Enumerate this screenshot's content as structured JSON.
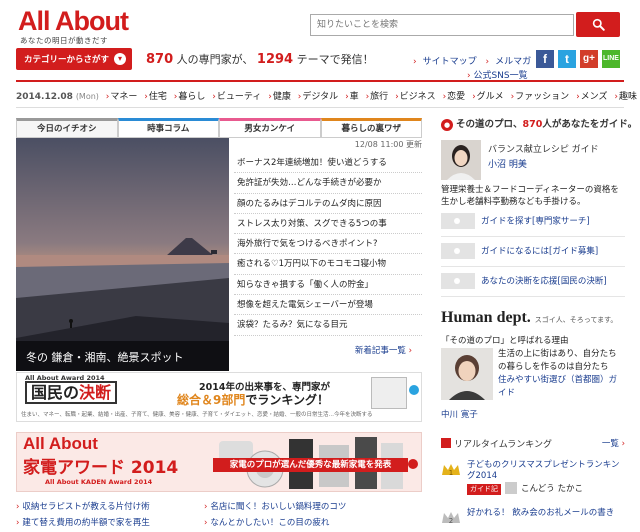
{
  "header": {
    "logo": "All About",
    "tagline": "あなたの明日が動きだす",
    "search_placeholder": "知りたいことを検索",
    "category_button": "カテゴリーからさがす",
    "promo_experts": "870",
    "promo_mid": "人の専門家が、",
    "promo_themes": "1294",
    "promo_end": "テーマで発信！",
    "links": [
      "サイトマップ",
      "メルマガ"
    ],
    "links_sns": "公式SNS一覧"
  },
  "datebar": {
    "date": "2014.12.08",
    "weekday": "(Mon)",
    "categories": [
      "マネー",
      "住宅",
      "暮らし",
      "ビューティ",
      "健康",
      "デジタル",
      "車",
      "旅行",
      "ビジネス",
      "恋愛",
      "グルメ",
      "ファッション",
      "メンズ",
      "趣味"
    ]
  },
  "tabs": [
    "今日のイチオシ",
    "時事コラム",
    "男女カンケイ",
    "暮らしの裏ワザ"
  ],
  "feature": {
    "caption": "冬の 鎌倉・湘南、絶景スポット",
    "timestamp": "12/08 11:00 更新",
    "news": [
      "ボーナス2年連続増加！使い道どうする",
      "免許証が失効…どんな手続きが必要か",
      "顔のたるみはデコルテのムダ肉に原因",
      "ストレス太り対策、スグできる5つの事",
      "海外旅行で気をつけるべきポイント?",
      "癒される♡1万円以下のモコモコ寝小物",
      "知らなきゃ損する「働く人の貯金」",
      "想像を超えた電気シェーバーが登場",
      "涙袋？たるみ？気になる目元"
    ],
    "more_link": "新着記事一覧"
  },
  "banner1": {
    "header": "All About Award 2014",
    "title_a": "国民の",
    "title_b": "決断",
    "line1": "2014年の出来事を、専門家が",
    "line2_a": "総合＆9部門",
    "line2_b": "でランキング！",
    "categories": "住まい、マネー、転職・起業、結婚・出産、子育て、健康、美容・健康、子育て・ダイエット、恋愛・結婚、一般の日常生活…今年を決断する"
  },
  "banner2": {
    "line1": "All About",
    "line2": "家電アワード 2014",
    "line3": "All About KADEN Award 2014",
    "tag": "家電のプロが選んだ優秀な最新家電を発表"
  },
  "bottom_links": [
    [
      "収納セラピストが教える片付け術",
      "名店に聞く！おいしい鍋料理のコツ"
    ],
    [
      "建て替え費用の約半額で家を再生",
      "なんとかしたい！この目の疲れ"
    ]
  ],
  "right": {
    "intro_a": "その道のプロ、",
    "intro_count": "870",
    "intro_b": "人があなたをガイド。",
    "guide_title": "バランス献立レシピ ガイド",
    "guide_name": "小沼 明美",
    "guide_desc": "管理栄養士＆フードコーディネーターの資格を生かし老舗料亭勤務なども手掛ける。",
    "actions": [
      "ガイドを探す[専門家サーチ]",
      "ガイドになるには[ガイド募集]",
      "あなたの決断を応援[国民の決断]"
    ],
    "human_title": "Human dept.",
    "human_tagline": "スゴイ人、そろってます。",
    "human_sub": "「その道のプロ」と呼ばれる理由",
    "pro_desc": "生活の上に街はあり、自分たちの暮らしを作るのは自分たち",
    "pro_role": "住みやすい街選び（首都圏）ガイド",
    "pro_name": "中川 寛子",
    "ranking_title": "リアルタイムランキング",
    "ranking_more": "一覧",
    "ranking": [
      {
        "rank": "1",
        "title": "子どものクリスマスプレゼントランキング2014",
        "badge": "ガイド記",
        "by": "こんどう たかこ"
      },
      {
        "rank": "2",
        "title": "好かれる！ 飲み会のお礼メールの書き"
      }
    ]
  },
  "colors": {
    "brand_red": "#d21d1d",
    "link_blue": "#1a3d8f"
  }
}
